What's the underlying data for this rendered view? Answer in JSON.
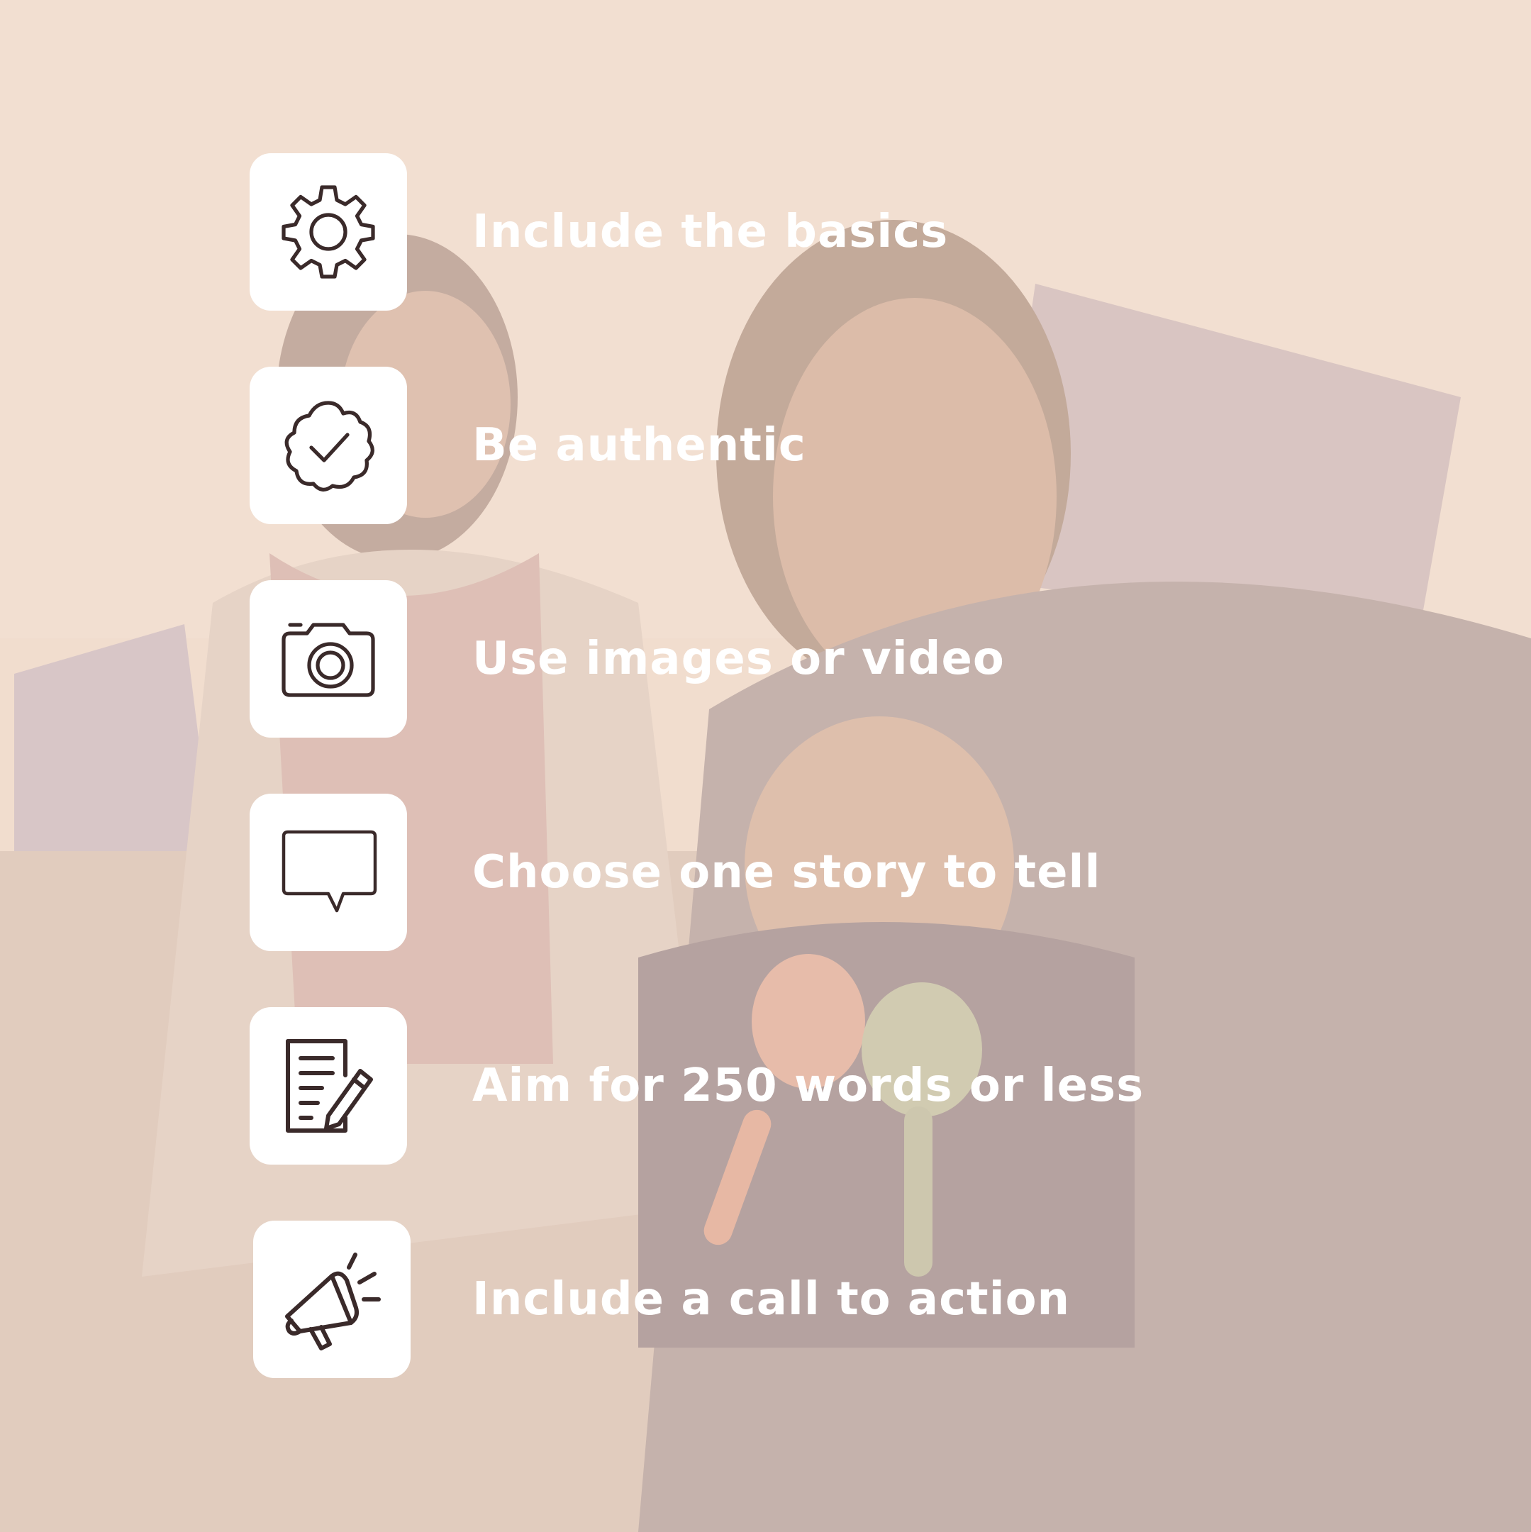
{
  "tips": [
    {
      "icon": "gear-icon",
      "label": "Include the basics"
    },
    {
      "icon": "verified-badge-icon",
      "label": "Be authentic"
    },
    {
      "icon": "camera-icon",
      "label": "Use images or video"
    },
    {
      "icon": "speech-bubble-icon",
      "label": "Choose one story to tell"
    },
    {
      "icon": "document-pencil-icon",
      "label": "Aim for 250 words or less"
    },
    {
      "icon": "megaphone-icon",
      "label": "Include a call to action"
    }
  ],
  "colors": {
    "overlay": "#f3dfcf",
    "icon_stroke": "#3a2a2a",
    "label": "#ffffff"
  }
}
